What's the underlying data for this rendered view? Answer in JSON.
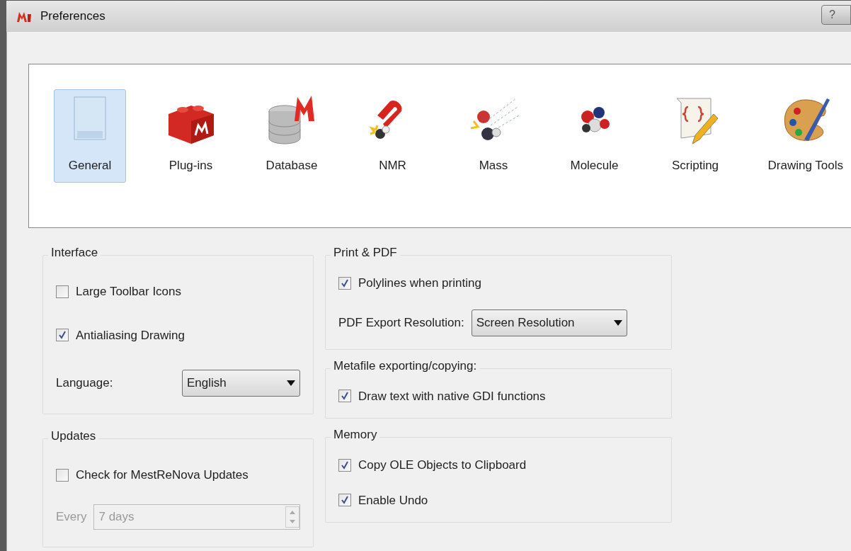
{
  "window": {
    "title": "Preferences",
    "help_button": "?"
  },
  "categories": [
    {
      "label": "General",
      "selected": true
    },
    {
      "label": "Plug-ins",
      "selected": false
    },
    {
      "label": "Database",
      "selected": false
    },
    {
      "label": "NMR",
      "selected": false
    },
    {
      "label": "Mass",
      "selected": false
    },
    {
      "label": "Molecule",
      "selected": false
    },
    {
      "label": "Scripting",
      "selected": false
    },
    {
      "label": "Drawing Tools",
      "selected": false
    }
  ],
  "columns": [
    [
      {
        "title": "Interface",
        "rows": [
          {
            "kind": "checkbox",
            "label": "Large Toolbar Icons",
            "checked": false
          },
          {
            "kind": "checkbox",
            "label": "Antialiasing Drawing",
            "checked": true
          },
          {
            "kind": "dropdown",
            "label": "Language:",
            "value": "English"
          }
        ]
      },
      {
        "title": "Updates",
        "rows": [
          {
            "kind": "checkbox",
            "label": "Check for MestReNova Updates",
            "checked": false
          },
          {
            "kind": "spinbox",
            "label": "Every",
            "value": "7 days",
            "disabled": true
          }
        ]
      }
    ],
    [
      {
        "title": "Print & PDF",
        "rows": [
          {
            "kind": "checkbox",
            "label": "Polylines when printing",
            "checked": true
          },
          {
            "kind": "dropdown",
            "label": "PDF Export Resolution:",
            "value": "Screen Resolution"
          }
        ]
      },
      {
        "title": "Metafile exporting/copying:",
        "rows": [
          {
            "kind": "checkbox",
            "label": "Draw text with native GDI functions",
            "checked": true
          }
        ]
      },
      {
        "title": "Memory",
        "rows": [
          {
            "kind": "checkbox",
            "label": "Copy OLE Objects to Clipboard",
            "checked": true
          },
          {
            "kind": "checkbox",
            "label": "Enable Undo",
            "checked": true
          }
        ]
      }
    ]
  ]
}
